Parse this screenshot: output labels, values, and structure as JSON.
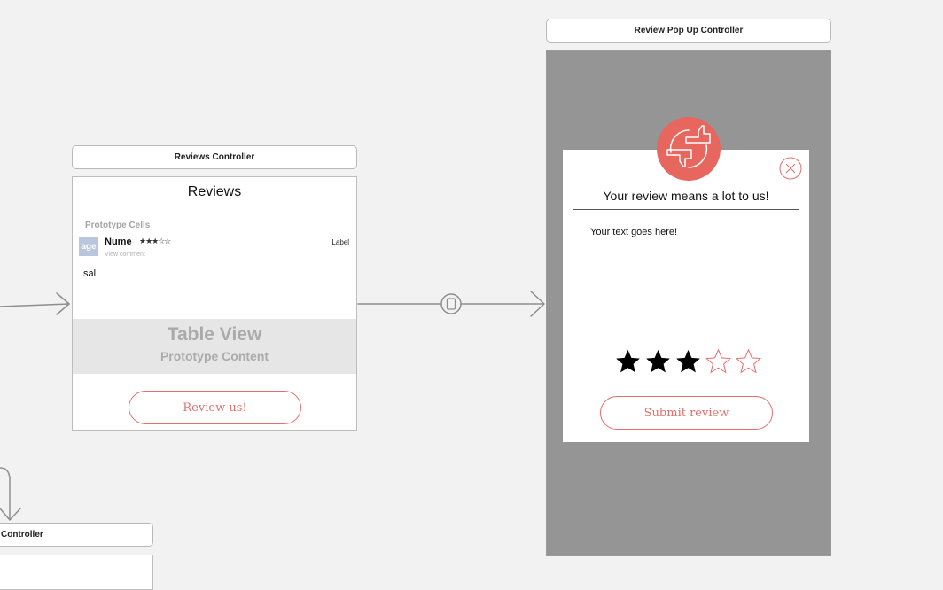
{
  "reviews_controller": {
    "title": "Reviews Controller",
    "nav_title": "Reviews",
    "prototype_cells_header": "Prototype Cells",
    "cell": {
      "image_text": "age",
      "name": "Nume",
      "stars": "★★★☆☆",
      "subtitle": "View comment",
      "right_label": "Label",
      "comment": "sal"
    },
    "table_view_title": "Table View",
    "table_view_subtitle": "Prototype Content",
    "review_button": "Review us!"
  },
  "review_popup_controller": {
    "title": "Review Pop Up Controller",
    "logo_icon": "thumbs-up-down-icon",
    "close_icon": "close-circle-icon",
    "heading": "Your review means a lot to us!",
    "placeholder_text": "Your text goes here!",
    "rating": {
      "value": 3,
      "max": 5
    },
    "submit_button": "Submit review"
  },
  "partial_controller": {
    "title": "Controller"
  },
  "colors": {
    "canvas": "#f2f2f2",
    "accent": "#e56e6e",
    "popup_background": "#959595",
    "segue_line": "#8e8e8e"
  }
}
